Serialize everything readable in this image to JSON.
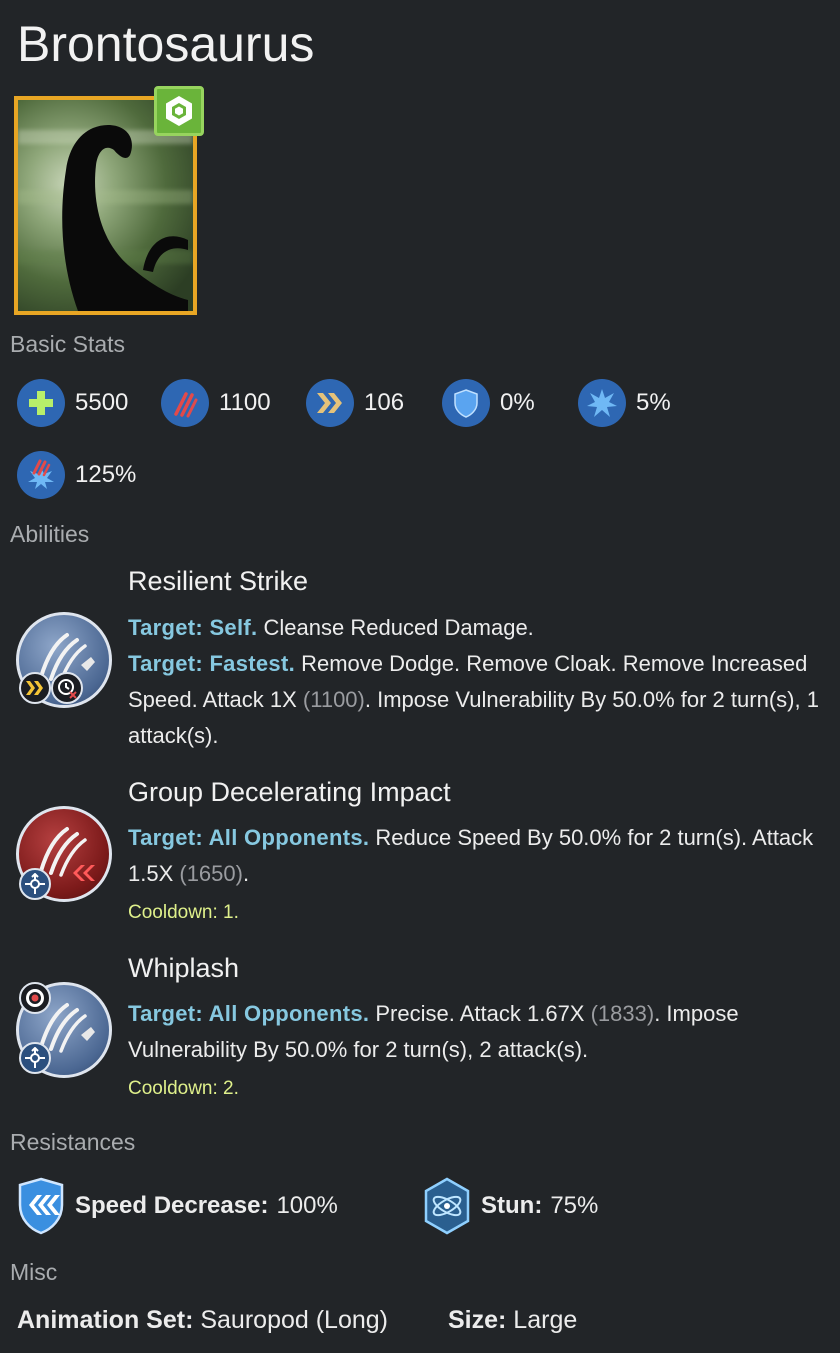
{
  "creature": {
    "name": "Brontosaurus"
  },
  "sections": {
    "basic_stats": "Basic Stats",
    "abilities": "Abilities",
    "resistances": "Resistances",
    "misc": "Misc"
  },
  "stats": {
    "health": "5500",
    "damage": "1100",
    "speed": "106",
    "armor": "0%",
    "critical_chance": "5%",
    "critical_multiplier": "125%"
  },
  "abilities": [
    {
      "name": "Resilient Strike",
      "lines": [
        {
          "target": "Target: Self.",
          "text": " Cleanse Reduced Damage."
        },
        {
          "target": "Target: Fastest.",
          "text": " Remove Dodge. Remove Cloak. Remove Increased Speed. Attack 1X ",
          "dim": "(1100)",
          "text2": ". Impose Vulnerability By 50.0% for 2 turn(s), 1 attack(s)."
        }
      ],
      "cooldown": ""
    },
    {
      "name": "Group Decelerating Impact",
      "lines": [
        {
          "target": "Target: All Opponents.",
          "text": " Reduce Speed By 50.0% for 2 turn(s). Attack 1.5X ",
          "dim": "(1650)",
          "text2": "."
        }
      ],
      "cooldown": "Cooldown: 1."
    },
    {
      "name": "Whiplash",
      "lines": [
        {
          "target": "Target: All Opponents.",
          "text": " Precise. Attack 1.67X ",
          "dim": "(1833)",
          "text2": ". Impose Vulnerability By 50.0% for 2 turn(s), 2 attack(s)."
        }
      ],
      "cooldown": "Cooldown: 2."
    }
  ],
  "resistances": [
    {
      "label": "Speed Decrease:",
      "value": " 100%"
    },
    {
      "label": "Stun:",
      "value": " 75%"
    }
  ],
  "misc": {
    "animation_label": "Animation Set:",
    "animation_value": " Sauropod (Long)",
    "size_label": "Size:",
    "size_value": " Large"
  },
  "colors": {
    "background": "#222528",
    "target_text": "#86c8e0",
    "cooldown_text": "#dff08b",
    "stat_icon_bg": "#2e67b3",
    "portrait_border": "#e8a624",
    "rarity_green": "#6ab43a"
  },
  "icons": {
    "health": "plus-icon",
    "damage": "claw-icon",
    "speed": "chevrons-icon",
    "armor": "shield-icon",
    "crit_chance": "burst-icon",
    "crit_multiplier": "claw-burst-icon",
    "speed_decrease": "speed-decrease-shield-icon",
    "stun": "stun-icon"
  }
}
